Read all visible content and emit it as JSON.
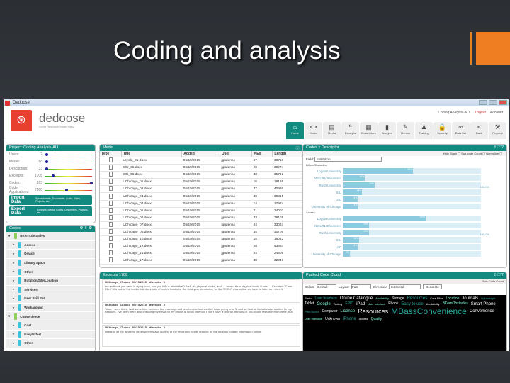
{
  "slide": {
    "title": "Coding and analysis"
  },
  "window": {
    "title": "Dedoose",
    "brand": "dedoose",
    "tagline": "Great Research Made Easy",
    "project": "Coding Analysis-ALL",
    "logout": "Logout",
    "account": "Account"
  },
  "nav": [
    {
      "label": "Home",
      "glyph": "⌂"
    },
    {
      "label": "Codes",
      "glyph": "<>"
    },
    {
      "label": "Media",
      "glyph": "▤"
    },
    {
      "label": "Excerpts",
      "glyph": "❝"
    },
    {
      "label": "Descriptors",
      "glyph": "▦"
    },
    {
      "label": "Analyze",
      "glyph": "▮"
    },
    {
      "label": "Memos",
      "glyph": "✎"
    },
    {
      "label": "Training",
      "glyph": "♟"
    },
    {
      "label": "Security",
      "glyph": "🔒"
    },
    {
      "label": "Data Set",
      "glyph": "∞"
    },
    {
      "label": "Back",
      "glyph": "<"
    },
    {
      "label": "Projects",
      "glyph": "⚒"
    }
  ],
  "project": {
    "header": "Project: Coding Analysis-ALL",
    "stats": [
      {
        "label": "Users:",
        "value": "2",
        "level": 0.02
      },
      {
        "label": "Media:",
        "value": "68",
        "level": 0.02
      },
      {
        "label": "Descriptors:",
        "value": "33",
        "level": 0.02
      },
      {
        "label": "Excerpts:",
        "value": "1708",
        "level": 0.15
      },
      {
        "label": "Codes:",
        "value": "263",
        "level": 1.0
      },
      {
        "label": "Code Applications:",
        "value": "2560",
        "level": 0.45
      }
    ],
    "import": {
      "label": "Import Data",
      "desc": "Spreadsheets, Documents, Audio, Video, Projects, etc."
    },
    "export": {
      "label": "Export Data",
      "desc": "Excerpts, Media, Codes, Descriptors, Projects, etc."
    }
  },
  "codes": {
    "header": "Codes",
    "items": [
      {
        "label": "BKernObstacles",
        "top": true
      },
      {
        "label": "Access"
      },
      {
        "label": "Device"
      },
      {
        "label": "Library Space"
      },
      {
        "label": "Other"
      },
      {
        "label": "Rotation/Site/Location"
      },
      {
        "label": "Services"
      },
      {
        "label": "User Skill Set"
      },
      {
        "label": "Workaround"
      },
      {
        "label": "Convenience",
        "top": true
      },
      {
        "label": "Cost"
      },
      {
        "label": "Easy/Effort"
      },
      {
        "label": "Other"
      }
    ]
  },
  "media": {
    "header": "Media",
    "columns": [
      "Type",
      "Title",
      "Added",
      "User",
      "# Ex",
      "Length"
    ],
    "rows": [
      [
        "Loyola_01.docx",
        "05/19/2015",
        "jgudenas",
        "67",
        "30716"
      ],
      [
        "CIU_05.docx",
        "05/19/2015",
        "jgudenas",
        "20",
        "30274"
      ],
      [
        "SIU_06.docx",
        "05/19/2015",
        "jgudenas",
        "33",
        "35792"
      ],
      [
        "UChicago_01.docx",
        "05/19/2015",
        "jgudenas",
        "16",
        "19186"
      ],
      [
        "UChicago_02.docx",
        "05/19/2015",
        "jgudenas",
        "37",
        "40999"
      ],
      [
        "UChicago_03.docx",
        "05/19/2015",
        "jgudenas",
        "30",
        "30815"
      ],
      [
        "UChicago_04.docx",
        "05/19/2015",
        "jgudenas",
        "14",
        "17974"
      ],
      [
        "UChicago_05.docx",
        "05/19/2015",
        "jgudenas",
        "21",
        "34001"
      ],
      [
        "UChicago_06.docx",
        "05/19/2015",
        "jgudenas",
        "33",
        "39108"
      ],
      [
        "UChicago_07.docx",
        "05/19/2015",
        "jgudenas",
        "24",
        "33067"
      ],
      [
        "UChicago_08.docx",
        "05/19/2015",
        "jgudenas",
        "35",
        "30706"
      ],
      [
        "UChicago_10.docx",
        "05/19/2015",
        "jgudenas",
        "15",
        "18042"
      ],
      [
        "UChicago_12.docx",
        "05/19/2015",
        "jgudenas",
        "28",
        "43884"
      ],
      [
        "UChicago_13.docx",
        "05/19/2015",
        "jgudenas",
        "24",
        "24506"
      ],
      [
        "UChicago_17.docx",
        "05/19/2015",
        "jgudenas",
        "38",
        "32948"
      ]
    ]
  },
  "excerpts": {
    "header": "Excerpts 1708",
    "items": [
      {
        "source": "UChicago_07.docx",
        "date": "05/19/2015",
        "user": "afterocks",
        "codes": "3",
        "text": "the textbook you need is dying book, can you tell us about that? Well, it's physical books, and... I mean, it's a physical book. It was — it's called \"Case Files\". It's one of the books that does a lot of review books for the third-year clerkships, for the SHELF exams that we have to take, so I want it."
      },
      {
        "source": "UChicago_02.docx",
        "date": "05/19/2015",
        "user": "afterocks",
        "codes": "3",
        "text": "Yeah, I went there, had some time between two meetings and another conference that I was going to at 5, and so I sat at the table and studied for my rotations. I've been there also checking my email on my phone at lunch time too. I don't have a distinct memory of, you know, research from there, but."
      },
      {
        "source": "UChicago_17.docx",
        "date": "05/19/2015",
        "user": "afterocks",
        "codes": "3",
        "text": "I think of all the amazing developments and looking at the electronic health records for the most up to date information online."
      }
    ]
  },
  "descriptor": {
    "header": "Codes x Descriptor",
    "options": [
      "Hide Blank",
      "Sub-code Count",
      "Normalize"
    ],
    "field_label": "Field:",
    "field": "Institution",
    "groups": [
      {
        "name": "BKernObstacles",
        "total": "100.0%",
        "bars": [
          {
            "label": "Loyola University",
            "value": 51
          },
          {
            "label": "NEIU/Northeastern",
            "value": 16
          },
          {
            "label": "Rush University",
            "value": 23
          },
          {
            "label": "SIU",
            "value": 14
          },
          {
            "label": "UIC",
            "value": 11
          },
          {
            "label": "University of Chicago",
            "value": 11
          }
        ]
      },
      {
        "name": "Access",
        "total": "100.0%",
        "bars": [
          {
            "label": "Loyola University",
            "value": 60
          },
          {
            "label": "NEIU/Northeastern",
            "value": 19
          },
          {
            "label": "Rush University",
            "value": 19
          },
          {
            "label": "SIU",
            "value": 12
          },
          {
            "label": "UIC",
            "value": 11
          },
          {
            "label": "University of Chicago",
            "value": 5
          }
        ]
      }
    ]
  },
  "cloud": {
    "header": "Packed Code Cloud",
    "subcode": "Sub-Code Count",
    "colors_label": "Colors:",
    "colors": "Default",
    "layout_label": "Layout:",
    "layout": "Fast",
    "direction_label": "Direction:",
    "direction": "Horizontal",
    "generate": "Generate",
    "words": [
      "Radio",
      "User Interface",
      "Online Catalogue",
      "Availability",
      "Storage",
      "Resources",
      "Core Files",
      "Location",
      "Journals",
      "Lightweight",
      "Tablet",
      "Google",
      "Testing",
      "EPIC",
      "iPad",
      "User Interface",
      "Ebook",
      "Easy to use",
      "Availability",
      "BKernObstacles",
      "Smart Phone",
      "Print Books",
      "Computer",
      "License",
      "Resources",
      "MBassConvenience",
      "Convenience",
      "User Interface",
      "Unknown",
      "iPhone",
      "Access",
      "Quality"
    ]
  }
}
